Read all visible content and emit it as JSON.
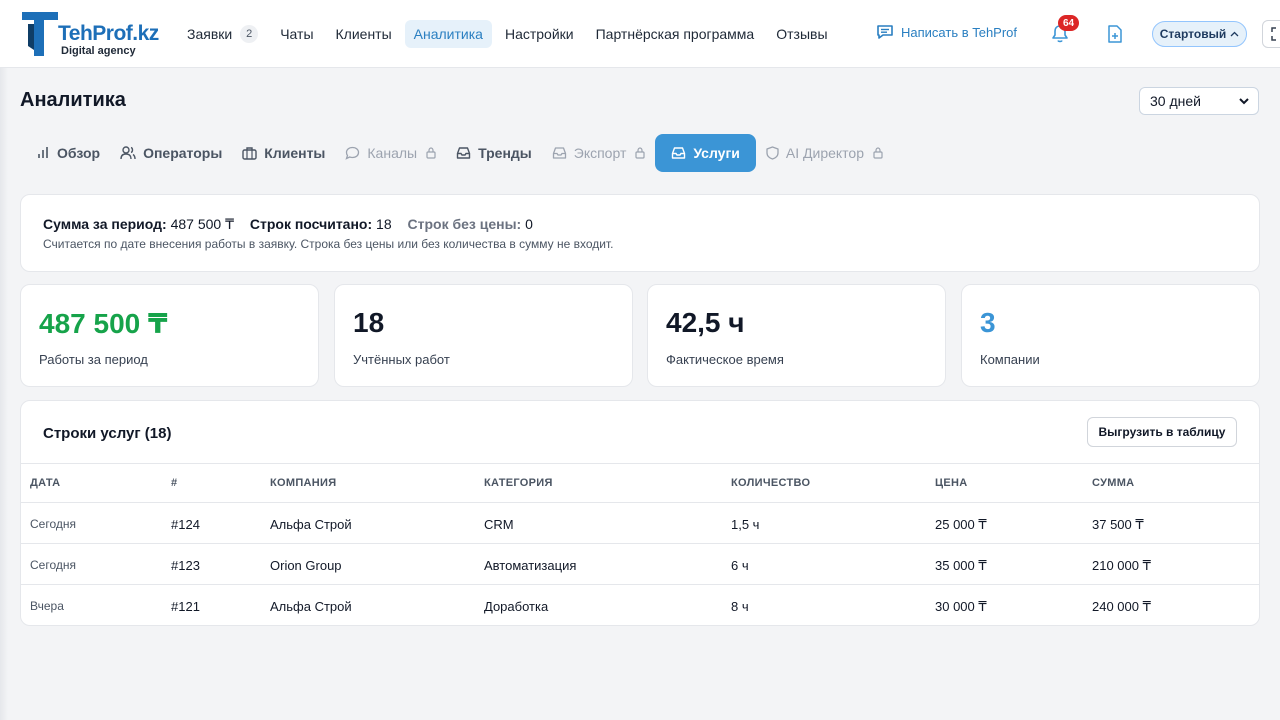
{
  "app": {
    "logo_name": "TehProf.kz",
    "logo_sub": "Digital agency"
  },
  "nav": {
    "items": [
      {
        "label": "Заявки",
        "badge": "2"
      },
      {
        "label": "Чаты"
      },
      {
        "label": "Клиенты"
      },
      {
        "label": "Аналитика",
        "active": true
      },
      {
        "label": "Настройки"
      },
      {
        "label": "Партнёрская программа"
      },
      {
        "label": "Отзывы"
      }
    ],
    "write_label": "Написать в TehProf",
    "notifications_count": "64",
    "plan_label": "Стартовый"
  },
  "page": {
    "title": "Аналитика",
    "period": "30 дней"
  },
  "tabs": [
    {
      "label": "Обзор",
      "icon": "bar-chart-icon",
      "disabled": false
    },
    {
      "label": "Операторы",
      "icon": "users-icon",
      "disabled": false
    },
    {
      "label": "Клиенты",
      "icon": "briefcase-icon",
      "disabled": false
    },
    {
      "label": "Каналы",
      "icon": "chat-bubble-icon",
      "disabled": true
    },
    {
      "label": "Тренды",
      "icon": "inbox-icon",
      "disabled": false
    },
    {
      "label": "Экспорт",
      "icon": "inbox-icon",
      "disabled": true
    },
    {
      "label": "Услуги",
      "icon": "inbox-icon",
      "active": true
    },
    {
      "label": "AI Директор",
      "icon": "shield-icon",
      "disabled": true
    }
  ],
  "summary": {
    "sum_label": "Сумма за период:",
    "sum_value": "487 500 ₸",
    "rows_label": "Строк посчитано:",
    "rows_value": "18",
    "noprice_label": "Строк без цены:",
    "noprice_value": "0",
    "note": "Считается по дате внесения работы в заявку. Строка без цены или без количества в сумму не входит."
  },
  "stats": [
    {
      "value": "487 500 ₸",
      "label": "Работы за период",
      "color": "#16a34a"
    },
    {
      "value": "18",
      "label": "Учтённых работ",
      "color": "#111827"
    },
    {
      "value": "42,5 ч",
      "label": "Фактическое время",
      "color": "#111827"
    },
    {
      "value": "3",
      "label": "Компании",
      "color": "#3b95d6"
    }
  ],
  "table": {
    "title": "Строки услуг (18)",
    "export_label": "Выгрузить в таблицу",
    "columns": [
      "ДАТА",
      "#",
      "КОМПАНИЯ",
      "КАТЕГОРИЯ",
      "КОЛИЧЕСТВО",
      "ЦЕНА",
      "СУММА"
    ],
    "rows": [
      [
        "Сегодня",
        "#124",
        "Альфа Строй",
        "CRM",
        "1,5 ч",
        "25 000 ₸",
        "37 500 ₸"
      ],
      [
        "Сегодня",
        "#123",
        "Orion Group",
        "Автоматизация",
        "6 ч",
        "35 000 ₸",
        "210 000 ₸"
      ],
      [
        "Вчера",
        "#121",
        "Альфа Строй",
        "Доработка",
        "8 ч",
        "30 000 ₸",
        "240 000 ₸"
      ]
    ]
  },
  "colors": {
    "accent": "#3b95d6",
    "success": "#16a34a",
    "danger": "#dc2626"
  }
}
